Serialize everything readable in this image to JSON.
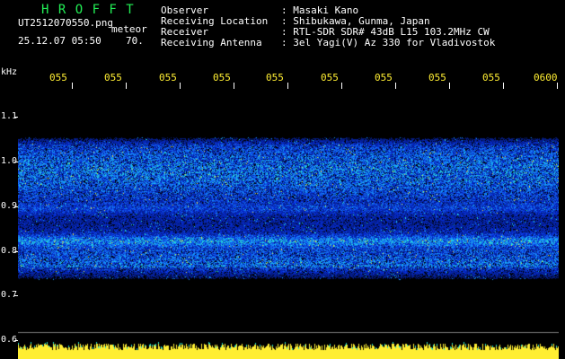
{
  "header": {
    "logo_text": "H R O F F T",
    "filename": "UT2512070550.png",
    "mode": "meteor",
    "date_time": "25.12.07 05:50",
    "gain": "70."
  },
  "info": {
    "rows": [
      {
        "label": "Observer",
        "value": ": Masaki Kano"
      },
      {
        "label": "Receiving Location",
        "value": ": Shibukawa, Gunma, Japan"
      },
      {
        "label": "Receiver",
        "value": ": RTL-SDR SDR# 43dB L15 103.2MHz CW"
      },
      {
        "label": "Receiving Antenna",
        "value": ": 3el Yagi(V) Az 330 for Vladivostok"
      }
    ]
  },
  "axes": {
    "y_unit": "kHz",
    "y_ticks": [
      "1.1",
      "1.0",
      "0.9",
      "0.8",
      "0.7",
      "0.6"
    ],
    "x_ticks": [
      "055",
      "055",
      "055",
      "055",
      "055",
      "055",
      "055",
      "055",
      "055",
      "0600"
    ]
  },
  "colors": {
    "background": "#000000",
    "logo": "#22ee55",
    "info_text": "#ffffff",
    "time_labels": "#ffee33",
    "signal_low": "#0a1a8a",
    "signal_mid": "#1e5cff",
    "signal_high": "#22e0c8",
    "signal_peak": "#ffee33"
  }
}
